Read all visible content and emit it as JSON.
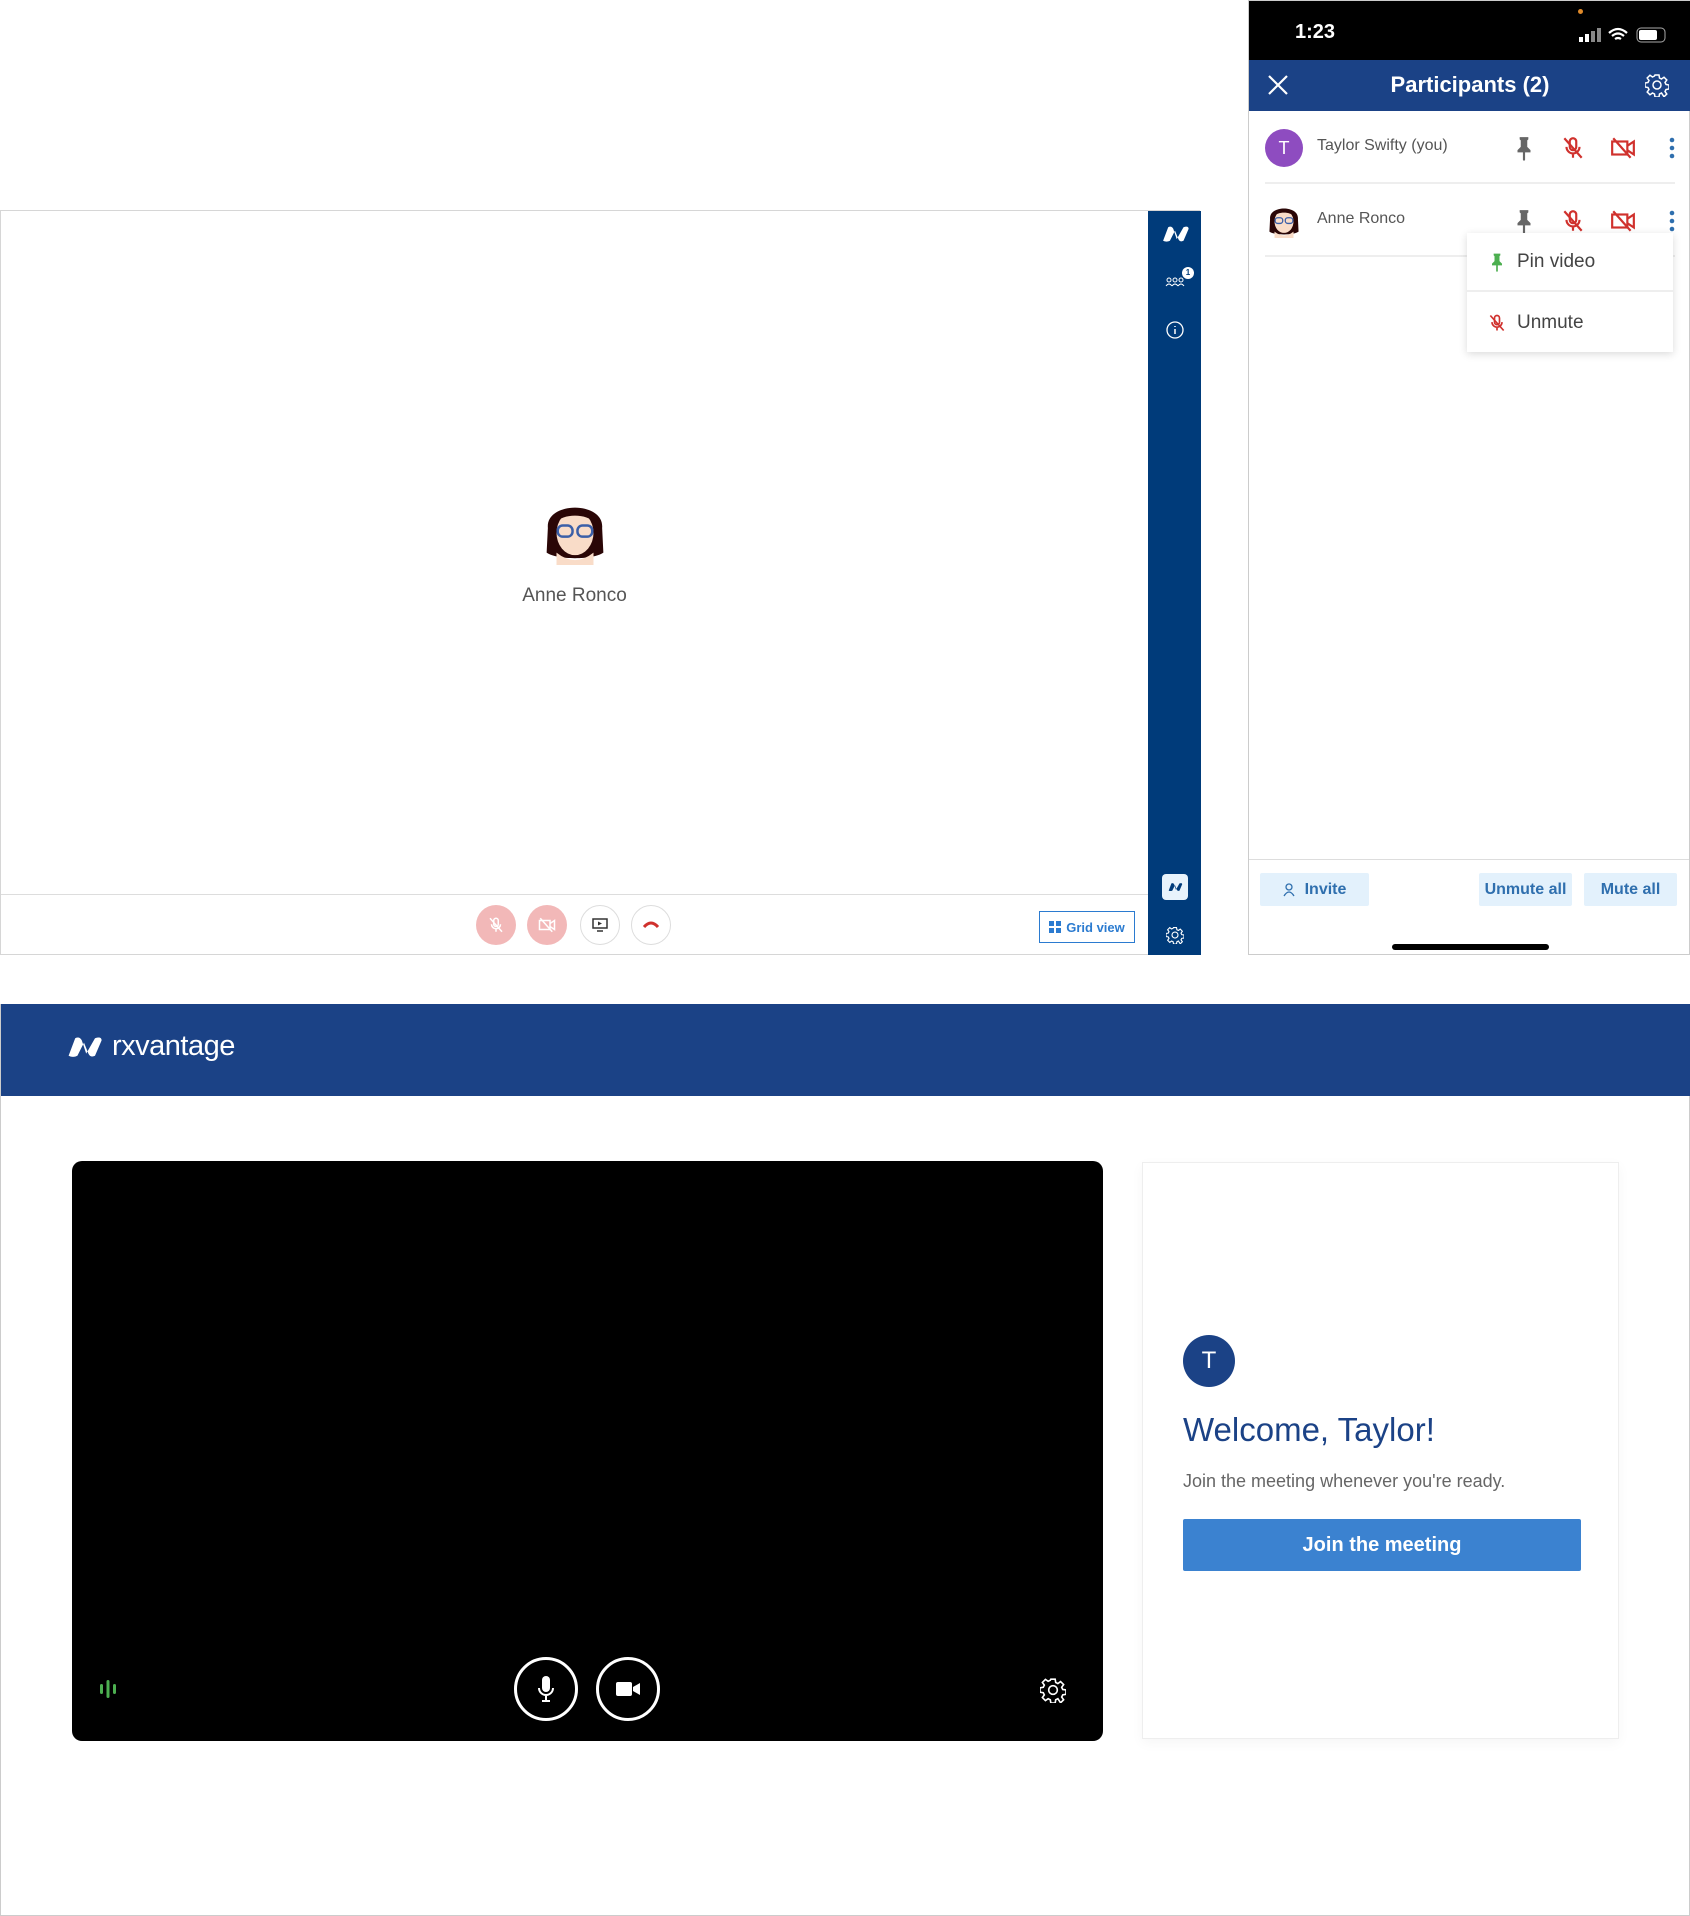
{
  "call": {
    "participant_name": "Anne Ronco",
    "grid_view_label": "Grid view",
    "participants_badge": "1",
    "colors": {
      "sidebar": "#003b7a",
      "muted": "#f2b8b8",
      "hangup": "#d0312d"
    }
  },
  "phone": {
    "time": "1:23",
    "title": "Participants (2)",
    "participants": [
      {
        "initial": "T",
        "name": "Taylor Swifty (you)",
        "avatar_color": "#8e4cc0"
      },
      {
        "name": "Anne Ronco"
      }
    ],
    "menu": [
      {
        "label": "Pin video",
        "icon": "pin-icon"
      },
      {
        "label": "Unmute",
        "icon": "mic-off-icon"
      }
    ],
    "invite_label": "Invite",
    "unmute_all_label": "Unmute all",
    "mute_all_label": "Mute all"
  },
  "lobby": {
    "brand": "rxvantage",
    "avatar_initial": "T",
    "welcome": "Welcome, Taylor!",
    "subtitle": "Join the meeting whenever you're ready.",
    "join_label": "Join the meeting",
    "colors": {
      "header": "#1b4286",
      "button": "#3b82d0",
      "audio": "#4caf50"
    }
  }
}
